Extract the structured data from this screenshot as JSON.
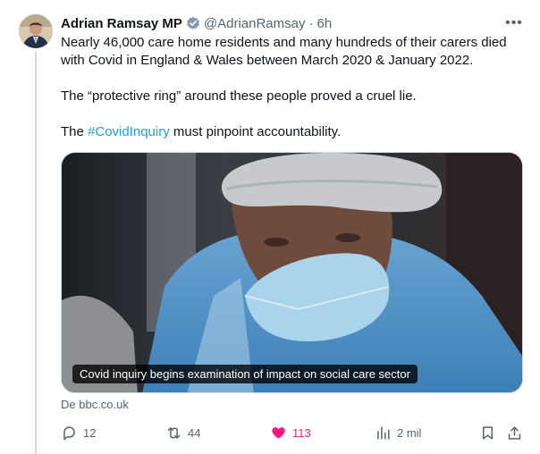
{
  "author": {
    "name": "Adrian Ramsay MP",
    "handle": "@AdrianRamsay",
    "separator": "·",
    "time": "6h"
  },
  "more_label": "•••",
  "text": {
    "line1": "Nearly 46,000 care home residents and many hundreds of their carers died",
    "line2": "with Covid in England & Wales between March 2020 & January 2022.",
    "para2": "The “protective ring” around these people proved a cruel lie.",
    "para3_before": "The ",
    "hashtag": "#CovidInquiry",
    "para3_after": " must pinpoint accountability."
  },
  "media": {
    "caption": "Covid inquiry begins examination of impact on social care sector"
  },
  "source": "De bbc.co.uk",
  "actions": {
    "replies": "12",
    "reposts": "44",
    "likes": "113",
    "views": "2 mil"
  },
  "colors": {
    "link": "#1d9bf0",
    "like": "#f91880",
    "secondary": "#536471"
  }
}
